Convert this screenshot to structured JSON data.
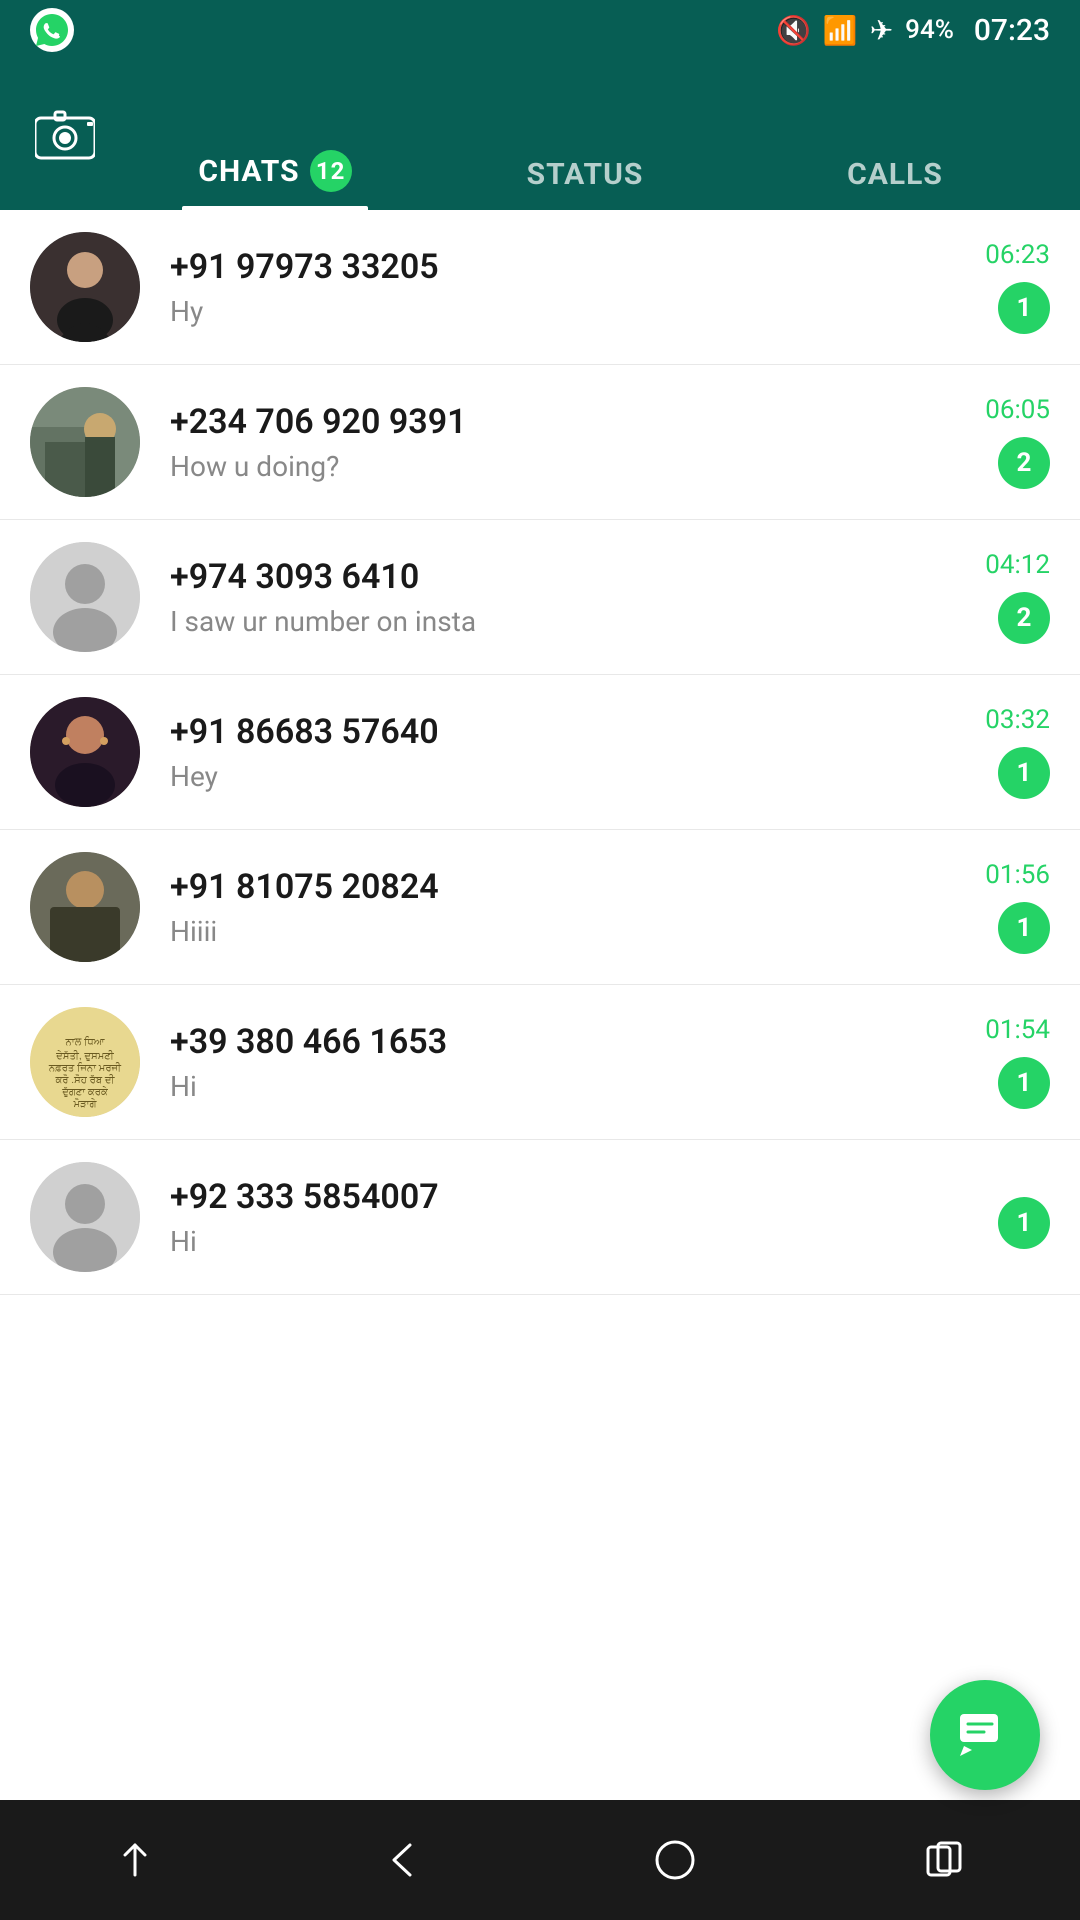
{
  "statusBar": {
    "time": "07:23",
    "battery": "94%",
    "icons": [
      "mute-icon",
      "wifi-icon",
      "airplane-icon",
      "battery-icon"
    ]
  },
  "header": {
    "cameraLabel": "📷",
    "tabs": [
      {
        "id": "chats",
        "label": "CHATS",
        "badge": "12",
        "active": true
      },
      {
        "id": "status",
        "label": "STATUS",
        "badge": null,
        "active": false
      },
      {
        "id": "calls",
        "label": "CALLS",
        "badge": null,
        "active": false
      }
    ]
  },
  "chats": [
    {
      "id": 1,
      "name": "+91 97973 33205",
      "preview": "Hy",
      "time": "06:23",
      "unread": "1",
      "avatarType": "photo1"
    },
    {
      "id": 2,
      "name": "+234 706 920 9391",
      "preview": "How u doing?",
      "time": "06:05",
      "unread": "2",
      "avatarType": "photo2"
    },
    {
      "id": 3,
      "name": "+974 3093 6410",
      "preview": "I saw ur number on insta",
      "time": "04:12",
      "unread": "2",
      "avatarType": "default"
    },
    {
      "id": 4,
      "name": "+91 86683 57640",
      "preview": "Hey",
      "time": "03:32",
      "unread": "1",
      "avatarType": "photo4"
    },
    {
      "id": 5,
      "name": "+91 81075 20824",
      "preview": "Hiiii",
      "time": "01:56",
      "unread": "1",
      "avatarType": "photo5"
    },
    {
      "id": 6,
      "name": "+39 380 466 1653",
      "preview": "Hi",
      "time": "01:54",
      "unread": "1",
      "avatarType": "photo6"
    },
    {
      "id": 7,
      "name": "+92 333 5854007",
      "preview": "Hi",
      "time": "",
      "unread": "1",
      "avatarType": "default"
    }
  ],
  "fab": {
    "icon": "chat-icon"
  },
  "navBar": {
    "buttons": [
      {
        "id": "back-soft",
        "icon": "chevron-down-icon"
      },
      {
        "id": "back-nav",
        "icon": "back-icon"
      },
      {
        "id": "home-nav",
        "icon": "home-icon"
      },
      {
        "id": "recents-nav",
        "icon": "recents-icon"
      }
    ]
  }
}
